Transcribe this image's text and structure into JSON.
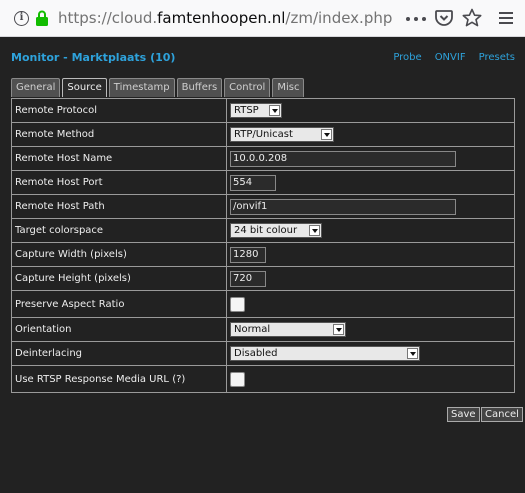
{
  "browser": {
    "url_prefix": "https://cloud.",
    "url_host": "famtenhoopen.nl",
    "url_path": "/zm/index.php"
  },
  "header": {
    "title": "Monitor - Marktplaats (10)",
    "links": [
      "Probe",
      "ONVIF",
      "Presets"
    ]
  },
  "tabs": [
    "General",
    "Source",
    "Timestamp",
    "Buffers",
    "Control",
    "Misc"
  ],
  "active_tab": "Source",
  "fields": {
    "remote_protocol": {
      "label": "Remote Protocol",
      "value": "RTSP"
    },
    "remote_method": {
      "label": "Remote Method",
      "value": "RTP/Unicast"
    },
    "remote_host_name": {
      "label": "Remote Host Name",
      "value": "10.0.0.208"
    },
    "remote_host_port": {
      "label": "Remote Host Port",
      "value": "554"
    },
    "remote_host_path": {
      "label": "Remote Host Path",
      "value": "/onvif1"
    },
    "target_colorspace": {
      "label": "Target colorspace",
      "value": "24 bit colour"
    },
    "capture_width": {
      "label": "Capture Width (pixels)",
      "value": "1280"
    },
    "capture_height": {
      "label": "Capture Height (pixels)",
      "value": "720"
    },
    "preserve_aspect": {
      "label": "Preserve Aspect Ratio",
      "checked": false
    },
    "orientation": {
      "label": "Orientation",
      "value": "Normal"
    },
    "deinterlacing": {
      "label": "Deinterlacing",
      "value": "Disabled"
    },
    "rtsp_media_url": {
      "label": "Use RTSP Response Media URL",
      "help": "(?)",
      "checked": false
    }
  },
  "buttons": {
    "save": "Save",
    "cancel": "Cancel"
  }
}
